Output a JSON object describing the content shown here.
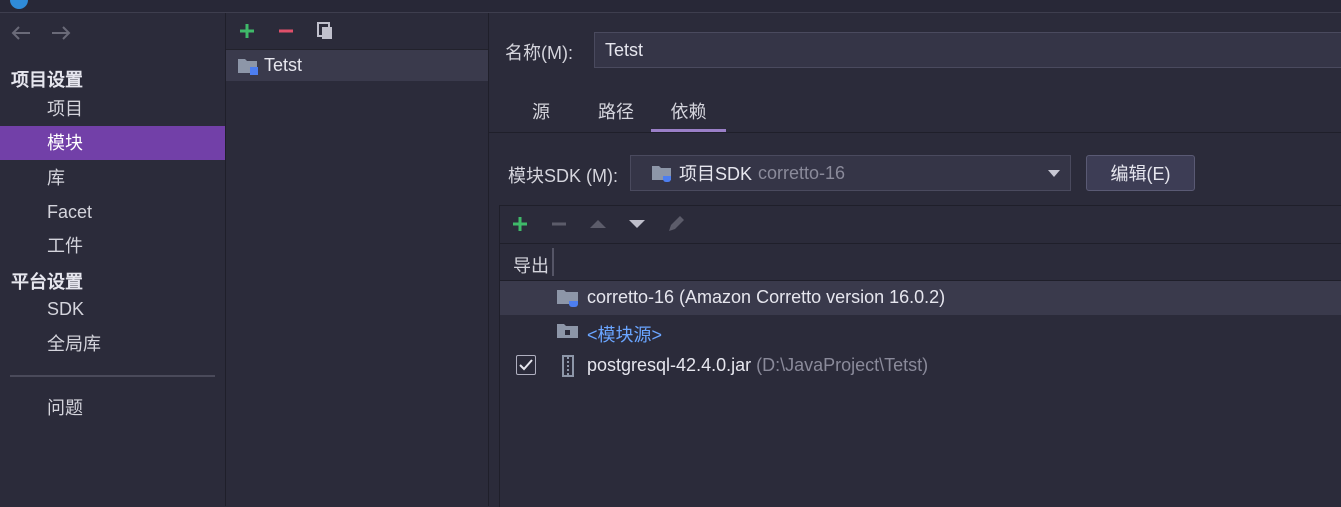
{
  "sidebar": {
    "section_project": "项目设置",
    "project_items": [
      {
        "label": "项目"
      },
      {
        "label": "模块",
        "selected": true
      },
      {
        "label": "库"
      },
      {
        "label": "Facet"
      },
      {
        "label": "工件"
      }
    ],
    "section_platform": "平台设置",
    "platform_items": [
      {
        "label": "SDK"
      },
      {
        "label": "全局库"
      }
    ],
    "problems": "问题"
  },
  "modules": {
    "items": [
      {
        "name": "Tetst"
      }
    ]
  },
  "detail": {
    "name_label": "名称(M):",
    "name_value": "Tetst",
    "tabs": [
      {
        "label": "源"
      },
      {
        "label": "路径"
      },
      {
        "label": "依赖",
        "active": true
      }
    ],
    "sdk_label": "模块SDK (M):",
    "sdk_value": "项目SDK",
    "sdk_value_detail": "corretto-16",
    "edit_label": "编辑(E)",
    "export_header": "导出",
    "dependencies": [
      {
        "name": "corretto-16 (Amazon Corretto version 16.0.2)",
        "kind": "sdk",
        "selected": true
      },
      {
        "name": "<模块源>",
        "kind": "module-source"
      },
      {
        "name": "postgresql-42.4.0.jar",
        "path": "(D:\\JavaProject\\Tetst)",
        "kind": "jar",
        "exported": true
      }
    ]
  },
  "colors": {
    "accent_selected": "#7240a8",
    "add_green": "#3fb969",
    "remove_red": "#e0506a",
    "link_blue": "#6aa5ff",
    "tab_underline": "#9a7fc7"
  }
}
